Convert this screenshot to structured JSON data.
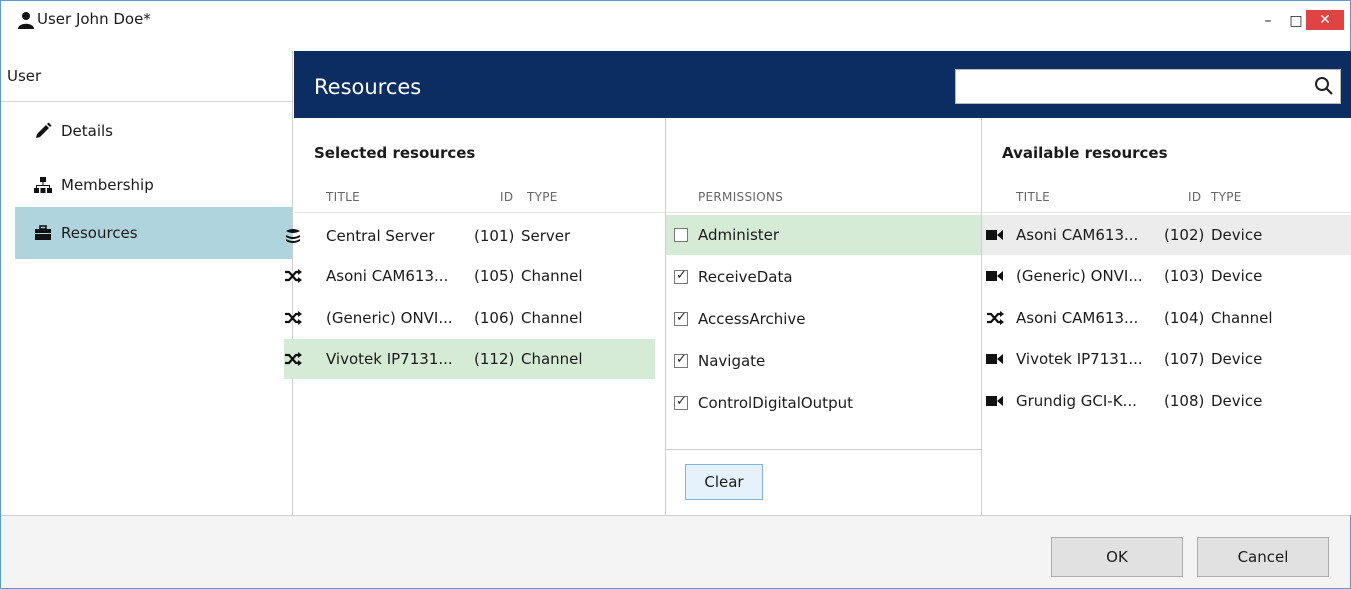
{
  "window": {
    "title": "User John Doe*",
    "minimize": "–",
    "maximize": "□",
    "close": "✕"
  },
  "sidebar": {
    "header": "User",
    "items": [
      {
        "label": "Details",
        "icon": "pencil-icon"
      },
      {
        "label": "Membership",
        "icon": "hierarchy-icon"
      },
      {
        "label": "Resources",
        "icon": "briefcase-icon",
        "active": true
      }
    ]
  },
  "header": {
    "title": "Resources",
    "search_placeholder": "",
    "search_value": ""
  },
  "selected_resources": {
    "title": "Selected resources",
    "columns": {
      "title": "TITLE",
      "id": "ID",
      "type": "TYPE"
    },
    "rows": [
      {
        "icon": "server-stack-icon",
        "title": "Central Server",
        "id": "(101)",
        "type": "Server"
      },
      {
        "icon": "shuffle-icon",
        "title": "Asoni CAM613...",
        "id": "(105)",
        "type": "Channel"
      },
      {
        "icon": "shuffle-icon",
        "title": "(Generic) ONVI...",
        "id": "(106)",
        "type": "Channel"
      },
      {
        "icon": "shuffle-icon",
        "title": "Vivotek IP7131...",
        "id": "(112)",
        "type": "Channel",
        "selected": true
      }
    ]
  },
  "permissions": {
    "column": "PERMISSIONS",
    "items": [
      {
        "label": "Administer",
        "checked": false,
        "selected": true
      },
      {
        "label": "ReceiveData",
        "checked": true
      },
      {
        "label": "AccessArchive",
        "checked": true
      },
      {
        "label": "Navigate",
        "checked": true
      },
      {
        "label": "ControlDigitalOutput",
        "checked": true
      }
    ],
    "clear_label": "Clear"
  },
  "available_resources": {
    "title": "Available resources",
    "columns": {
      "title": "TITLE",
      "id": "ID",
      "type": "TYPE"
    },
    "rows": [
      {
        "icon": "camera-icon",
        "title": "Asoni CAM613...",
        "id": "(102)",
        "type": "Device",
        "hover": true
      },
      {
        "icon": "camera-icon",
        "title": "(Generic) ONVI...",
        "id": "(103)",
        "type": "Device"
      },
      {
        "icon": "shuffle-icon",
        "title": "Asoni CAM613...",
        "id": "(104)",
        "type": "Channel"
      },
      {
        "icon": "camera-icon",
        "title": "Vivotek IP7131...",
        "id": "(107)",
        "type": "Device"
      },
      {
        "icon": "camera-icon",
        "title": "Grundig GCI-K...",
        "id": "(108)",
        "type": "Device"
      }
    ]
  },
  "footer": {
    "ok_label": "OK",
    "cancel_label": "Cancel"
  },
  "colors": {
    "header_bg": "#0b2d62",
    "nav_active": "#b0d4dd",
    "row_selected": "#d6ebd6",
    "close_button": "#e04343"
  }
}
